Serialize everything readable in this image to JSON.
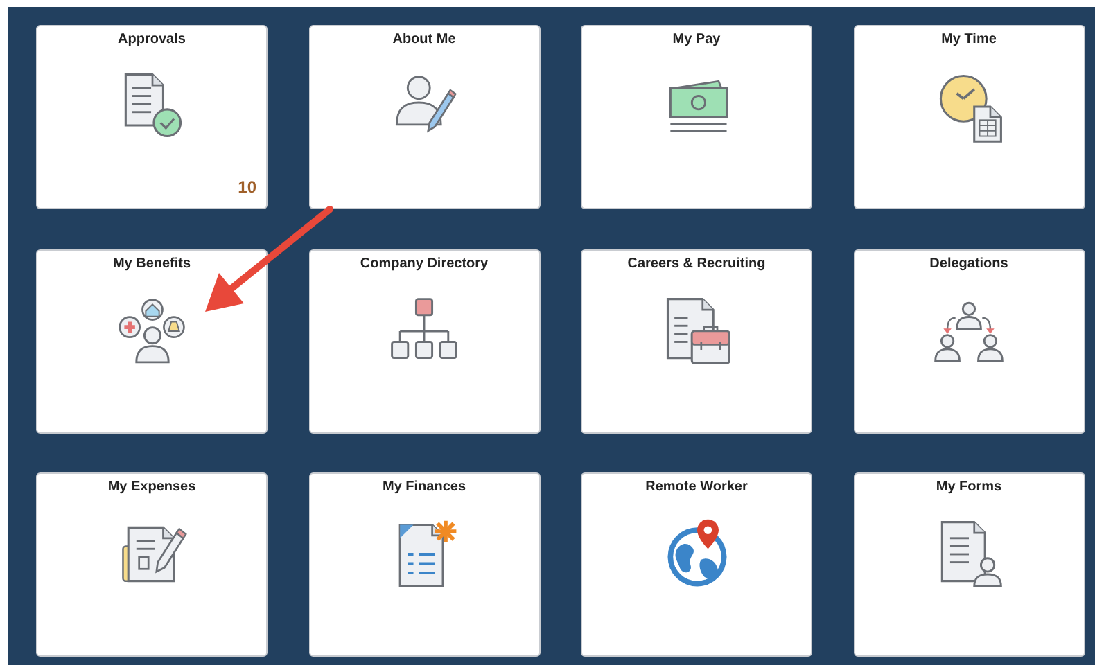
{
  "tiles": [
    {
      "title": "Approvals",
      "count": "10"
    },
    {
      "title": "About Me"
    },
    {
      "title": "My Pay"
    },
    {
      "title": "My Time"
    },
    {
      "title": "My Benefits"
    },
    {
      "title": "Company Directory"
    },
    {
      "title": "Careers & Recruiting"
    },
    {
      "title": "Delegations"
    },
    {
      "title": "My Expenses"
    },
    {
      "title": "My Finances"
    },
    {
      "title": "Remote Worker"
    },
    {
      "title": "My Forms"
    }
  ]
}
